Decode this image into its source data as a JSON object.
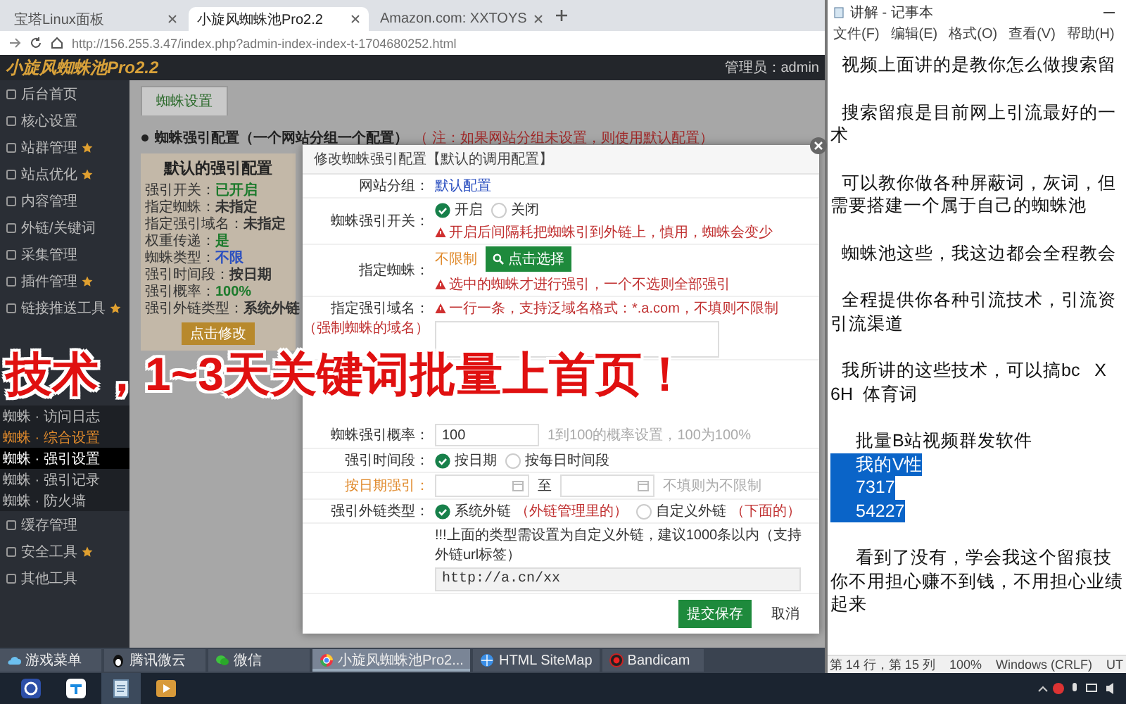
{
  "browser": {
    "tabs": [
      {
        "title": "宝塔Linux面板",
        "selected": false
      },
      {
        "title": "小旋风蜘蛛池Pro2.2",
        "selected": true
      },
      {
        "title": "Amazon.com: XXTOYS",
        "selected": false
      }
    ],
    "url": "http://156.255.3.47/index.php?admin-index-index-t-1704680252.html"
  },
  "app": {
    "logo": "小旋风蜘蛛池Pro2.2",
    "user": "管理员：admin"
  },
  "sidebar": {
    "items": [
      {
        "label": "后台首页",
        "kind": "main",
        "star": false,
        "selected": false,
        "highlighted": false
      },
      {
        "label": "核心设置",
        "kind": "main",
        "star": false,
        "selected": false,
        "highlighted": false
      },
      {
        "label": "站群管理",
        "kind": "main",
        "star": true,
        "selected": false,
        "highlighted": false
      },
      {
        "label": "站点优化",
        "kind": "main",
        "star": true,
        "selected": false,
        "highlighted": false
      },
      {
        "label": "内容管理",
        "kind": "main",
        "star": false,
        "selected": false,
        "highlighted": false
      },
      {
        "label": "外链/关键词",
        "kind": "main",
        "star": false,
        "selected": false,
        "highlighted": false
      },
      {
        "label": "采集管理",
        "kind": "main",
        "star": false,
        "selected": false,
        "highlighted": false
      },
      {
        "label": "插件管理",
        "kind": "main",
        "star": true,
        "selected": false,
        "highlighted": false
      },
      {
        "label": "链接推送工具",
        "kind": "main",
        "star": true,
        "selected": false,
        "highlighted": false
      },
      {
        "label": "蜘蛛 · 访问日志",
        "kind": "sub",
        "star": false,
        "selected": false,
        "highlighted": false
      },
      {
        "label": "蜘蛛 · 综合设置",
        "kind": "sub",
        "star": false,
        "selected": false,
        "highlighted": true
      },
      {
        "label": "蜘蛛 · 强引设置",
        "kind": "sub",
        "star": false,
        "selected": true,
        "highlighted": false
      },
      {
        "label": "蜘蛛 · 强引记录",
        "kind": "sub",
        "star": false,
        "selected": false,
        "highlighted": false
      },
      {
        "label": "蜘蛛 · 防火墙",
        "kind": "sub",
        "star": false,
        "selected": false,
        "highlighted": false
      },
      {
        "label": "缓存管理",
        "kind": "main",
        "star": false,
        "selected": false,
        "highlighted": false
      },
      {
        "label": "安全工具",
        "kind": "main",
        "star": true,
        "selected": false,
        "highlighted": false
      },
      {
        "label": "其他工具",
        "kind": "main",
        "star": false,
        "selected": false,
        "highlighted": false
      }
    ]
  },
  "page": {
    "tab": "蜘蛛设置",
    "heading": "蜘蛛强引配置（一个网站分组一个配置）",
    "note": "（ 注：如果网站分组未设置，则使用默认配置）",
    "card": {
      "title": "默认的强引配置",
      "button": "点击修改",
      "fields": [
        {
          "label": "强引开关：",
          "value": "已开启",
          "color": "#1c7a2c"
        },
        {
          "label": "指定蜘蛛：",
          "value": "未指定",
          "color": "#333333"
        },
        {
          "label": "指定强引域名：",
          "value": "未指定",
          "color": "#333333"
        },
        {
          "label": "权重传递：",
          "value": "是",
          "color": "#1c7a2c"
        },
        {
          "label": "蜘蛛类型：",
          "value": "不限",
          "color": "#2a4fc0"
        },
        {
          "label": "强引时间段：",
          "value": "按日期",
          "color": "#333333"
        },
        {
          "label": "强引概率：",
          "value": "100%",
          "color": "#1c7a2c"
        },
        {
          "label": "强引外链类型：",
          "value": "系统外链",
          "color": "#333333"
        }
      ]
    }
  },
  "modal": {
    "title": "修改蜘蛛强引配置【默认的调用配置】",
    "submit": "提交保存",
    "cancel": "取消",
    "rows": [
      {
        "kind": "text",
        "label": "网站分组：",
        "highlighted": false,
        "value": "默认配置"
      },
      {
        "kind": "radio",
        "label": "蜘蛛强引开关：",
        "highlighted": false,
        "options": [
          {
            "label": "开启",
            "selected": true
          },
          {
            "label": "关闭",
            "selected": false
          }
        ],
        "warning": "开启后间隔耗把蜘蛛引到外链上，慎用，蜘蛛会变少"
      },
      {
        "kind": "picker",
        "label": "指定蜘蛛：",
        "highlighted": false,
        "value": "不限制",
        "button": "点击选择",
        "warning": "选中的蜘蛛才进行强引，一个不选则全部强引"
      },
      {
        "kind": "textarea",
        "label": "指定强引域名：",
        "sublabel": "（强制蜘蛛的域名）",
        "highlighted": false,
        "hint": "一行一条，支持泛域名格式：*.a.com，不填则不限制"
      },
      {
        "kind": "input",
        "label": "蜘蛛强引概率：",
        "highlighted": false,
        "value": "100",
        "hint": "1到100的概率设置，100为100%"
      },
      {
        "kind": "radio",
        "label": "强引时间段：",
        "highlighted": false,
        "options": [
          {
            "label": "按日期",
            "selected": true
          },
          {
            "label": "按每日时间段",
            "selected": false
          }
        ]
      },
      {
        "kind": "daterange",
        "label": "按日期强引：",
        "highlighted": true,
        "separator": "至",
        "hint": "不填则为不限制"
      },
      {
        "kind": "radio",
        "label": "强引外链类型：",
        "highlighted": false,
        "options": [
          {
            "label": "系统外链",
            "note": "（外链管理里的）",
            "selected": true
          },
          {
            "label": "自定义外链",
            "note": "（下面的）",
            "selected": false
          }
        ]
      },
      {
        "kind": "links",
        "note": "!!!上面的类型需设置为自定义外链，建议1000条以内（支持外链url标签）",
        "value": "http://a.cn/xx"
      }
    ]
  },
  "caption": "技术，1~3天关键词批量上首页！",
  "notepad": {
    "title": "讲解 - 记事本",
    "menu": [
      "文件(F)",
      "编辑(E)",
      "格式(O)",
      "查看(V)",
      "帮助(H)"
    ],
    "paragraphs": [
      {
        "lines": [
          {
            "text": "视频上面讲的是教你怎么做搜索留",
            "kind": "first",
            "selected": false
          }
        ]
      },
      {
        "lines": [
          {
            "text": "搜索留痕是目前网上引流最好的一",
            "kind": "first",
            "selected": false
          },
          {
            "text": "术",
            "kind": "wrap",
            "selected": false
          }
        ]
      },
      {
        "lines": [
          {
            "text": "可以教你做各种屏蔽词，灰词，但",
            "kind": "first",
            "selected": false
          },
          {
            "text": "需要搭建一个属于自己的蜘蛛池",
            "kind": "wrap",
            "selected": false
          }
        ]
      },
      {
        "lines": [
          {
            "text": "蜘蛛池这些，我这边都会全程教会",
            "kind": "first",
            "selected": false
          }
        ]
      },
      {
        "lines": [
          {
            "text": "全程提供你各种引流技术，引流资",
            "kind": "first",
            "selected": false
          },
          {
            "text": "引流渠道",
            "kind": "wrap",
            "selected": false
          }
        ]
      },
      {
        "lines": [
          {
            "text": "我所讲的这些技术，可以搞bc   X",
            "kind": "first",
            "selected": false
          },
          {
            "text": "6H  体育词",
            "kind": "wrap",
            "selected": false
          }
        ]
      },
      {
        "lines": [
          {
            "text": "批量B站视频群发软件",
            "kind": "deep",
            "selected": false
          },
          {
            "text": "我的V性",
            "kind": "deep",
            "selected": true
          },
          {
            "text": "7317",
            "kind": "deep",
            "selected": true
          },
          {
            "text": "54227",
            "kind": "deep",
            "selected": true
          }
        ]
      },
      {
        "lines": [
          {
            "text": "看到了没有，学会我这个留痕技",
            "kind": "deep",
            "selected": false
          },
          {
            "text": "你不用担心赚不到钱，不用担心业绩",
            "kind": "wrap",
            "selected": false
          },
          {
            "text": "起来",
            "kind": "wrap",
            "selected": false
          }
        ]
      }
    ],
    "status": [
      "第 14 行，第 15 列",
      "100%",
      "Windows (CRLF)",
      "UT"
    ]
  },
  "taskbar_windows": [
    {
      "label": "游戏菜单",
      "kind": "cloud",
      "selected": false
    },
    {
      "label": "腾讯微云",
      "kind": "penguin",
      "selected": false
    },
    {
      "label": "微信",
      "kind": "chat",
      "selected": false
    },
    {
      "label": "小旋风蜘蛛池Pro2...",
      "kind": "browser",
      "selected": true
    },
    {
      "label": "HTML SiteMap",
      "kind": "globe",
      "selected": false
    },
    {
      "label": "Bandicam",
      "kind": "record",
      "selected": false
    }
  ],
  "taskbar_apps": [
    {
      "kind": "circle",
      "selected": false
    },
    {
      "kind": "tile",
      "selected": false
    },
    {
      "kind": "notepad",
      "selected": true
    },
    {
      "kind": "player",
      "selected": false
    }
  ]
}
